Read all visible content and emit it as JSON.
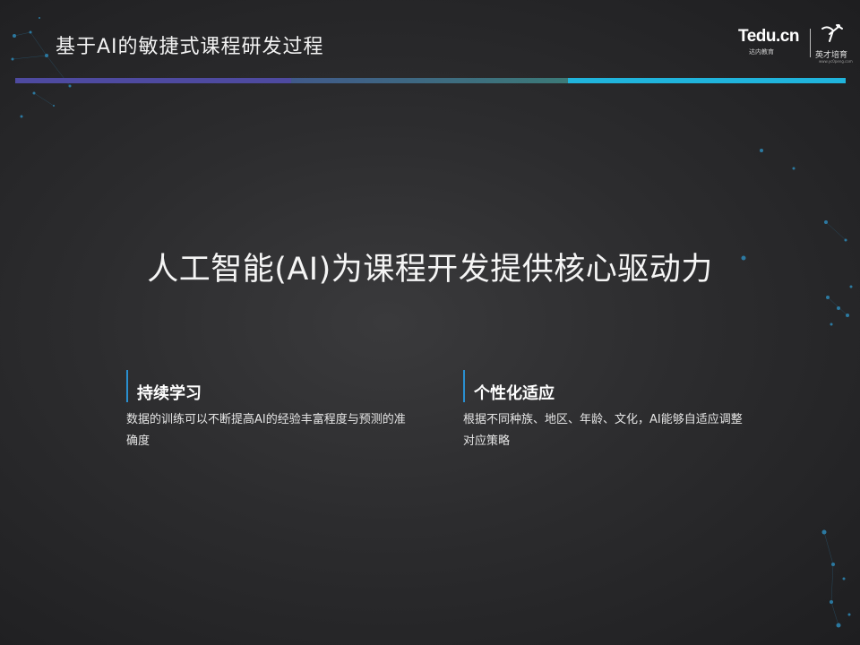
{
  "header": {
    "title": "基于AI的敏捷式课程研发过程"
  },
  "logo": {
    "tedu": "Tedu.cn",
    "tedu_sub": "达内教育",
    "brand2": "英才培育",
    "url": "www.yc0peng.com"
  },
  "main": {
    "headline": "人工智能(AI)为课程开发提供核心驱动力"
  },
  "cards": [
    {
      "title": "持续学习",
      "text": "数据的训练可以不断提高AI的经验丰富程度与预测的准确度"
    },
    {
      "title": "个性化适应",
      "text": "根据不同种族、地区、年龄、文化，AI能够自适应调整对应策略"
    }
  ],
  "colors": {
    "background": "#2c2c2e",
    "rule_segment_1": "#4e4aa0",
    "rule_segment_2": "#3c7a78",
    "rule_segment_3": "#20b4dc",
    "card_accent": "#2a8fd0"
  }
}
